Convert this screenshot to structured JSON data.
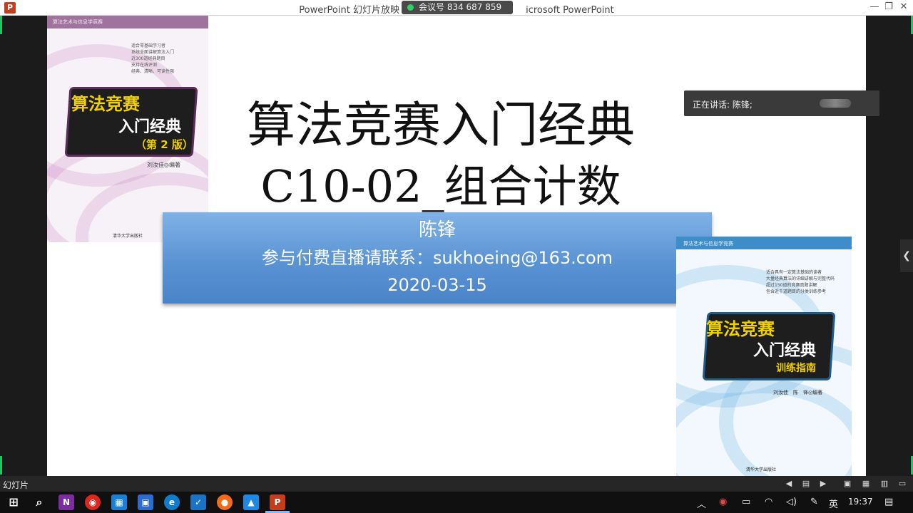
{
  "window": {
    "title": "PowerPoint 幻灯片放映 - [C1... - Microsoft PowerPoint",
    "title_left": "PowerPoint 幻灯片放映 - [C",
    "title_right": "icrosoft PowerPoint",
    "meeting_id": "会议号 834 687 859",
    "minimize": "—",
    "restore": "❐",
    "close": "✕"
  },
  "slide": {
    "title": "算法竞赛入门经典",
    "subtitle": "C10-02_组合计数",
    "presenter": "陈锋",
    "contact": "参与付费直播请联系：sukhoeing@163.com",
    "date": "2020-03-15"
  },
  "book1": {
    "series": "算法艺术与信息学竞赛",
    "title_line1": "算法竞赛",
    "title_line2": "入门经典",
    "edition": "（第 2 版）",
    "author": "刘汝佳◎编著",
    "publisher": "清华大学出版社",
    "bullets": [
      "适合零基础学习者",
      "系统全面讲解算法入门",
      "近300道经典题目",
      "支持在线评测",
      "经典、清晰、可读性强"
    ]
  },
  "book2": {
    "series": "算法艺术与信息学竞赛",
    "title_line1": "算法竞赛",
    "title_line2": "入门经典",
    "subtitle": "训练指南",
    "author": "刘汝佳　陈　锋◎编著",
    "publisher": "清华大学出版社",
    "bullets": [
      "适合具有一定算法基础的读者",
      "大量经典算法的详细讲解与完整代码",
      "超过150道的竞赛真题讲解",
      "包含近千道题目的分类训练参考"
    ]
  },
  "speaking": {
    "text": "正在讲话: 陈锋;"
  },
  "statusbar": {
    "label": "幻灯片",
    "prev": "◀",
    "menu": "▤",
    "next": "▶"
  },
  "taskbar": {
    "time": "19:37",
    "ime": "英",
    "icons": [
      "windows-start",
      "search",
      "onenote",
      "netease-music",
      "calendar",
      "save",
      "edge",
      "todo",
      "firefox",
      "remote",
      "powerpoint"
    ],
    "colors": {
      "onenote": "#7b2ca0",
      "netease": "#d8281f",
      "calendar": "#1b7fd6",
      "save": "#2c6bd0",
      "edge": "#0f7dcc",
      "todo": "#1a73c4",
      "firefox": "#f06b1a",
      "remote": "#1e88e5",
      "powerpoint": "#c43e1c"
    }
  }
}
